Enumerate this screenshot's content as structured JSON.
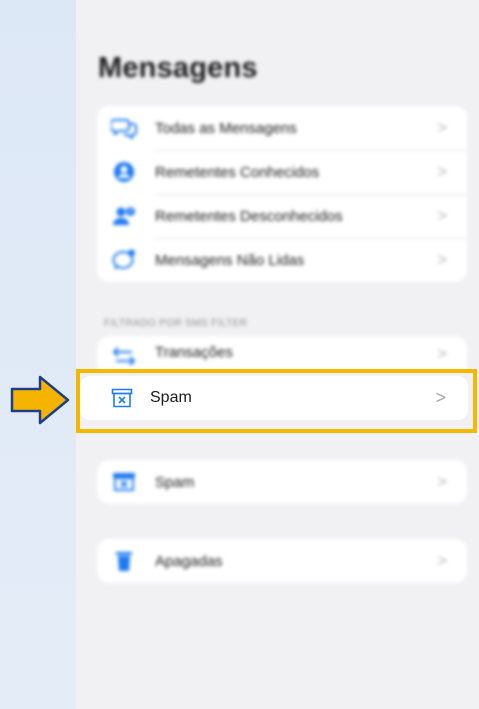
{
  "title": "Mensagens",
  "group1": {
    "items": [
      {
        "label": "Todas as Mensagens",
        "icon": "chat-bubbles-icon"
      },
      {
        "label": "Remetentes Conhecidos",
        "icon": "person-circle-icon"
      },
      {
        "label": "Remetentes Desconhecidos",
        "icon": "person-question-icon"
      },
      {
        "label": "Mensagens Não Lidas",
        "icon": "unread-bubble-icon"
      }
    ]
  },
  "filter_section": {
    "header": "FILTRADO POR SMS FILTER",
    "transactions_label": "Transações"
  },
  "highlighted": {
    "label": "Spam",
    "icon": "spam-tray-icon"
  },
  "group3": {
    "label": "Spam",
    "icon": "spam-tray-icon"
  },
  "group4": {
    "label": "Apagadas",
    "icon": "trash-icon"
  },
  "chevron": ">",
  "colors": {
    "accent": "#1e7bf2",
    "highlight": "#f4b800",
    "arrow_fill": "#f5b400",
    "arrow_stroke": "#1d3f8a"
  }
}
